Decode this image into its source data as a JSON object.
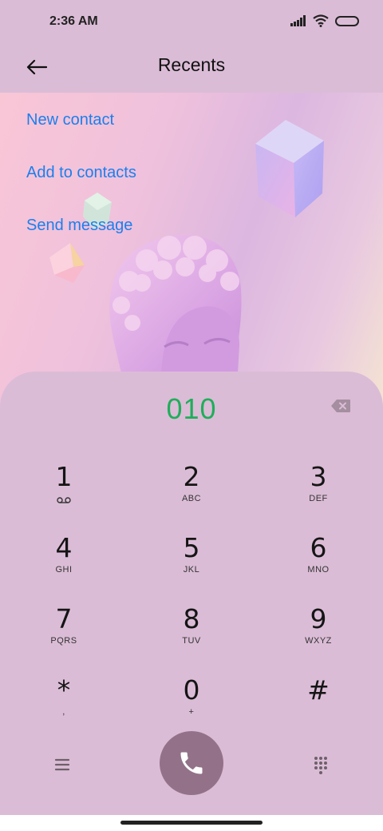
{
  "status_bar": {
    "time": "2:36 AM"
  },
  "header": {
    "title": "Recents"
  },
  "actions": [
    {
      "label": "New contact"
    },
    {
      "label": "Add to contacts"
    },
    {
      "label": "Send message"
    }
  ],
  "dialer": {
    "number": "010",
    "keys": [
      {
        "digit": "1",
        "letters": ""
      },
      {
        "digit": "2",
        "letters": "ABC"
      },
      {
        "digit": "3",
        "letters": "DEF"
      },
      {
        "digit": "4",
        "letters": "GHI"
      },
      {
        "digit": "5",
        "letters": "JKL"
      },
      {
        "digit": "6",
        "letters": "MNO"
      },
      {
        "digit": "7",
        "letters": "PQRS"
      },
      {
        "digit": "8",
        "letters": "TUV"
      },
      {
        "digit": "9",
        "letters": "WXYZ"
      },
      {
        "digit": "*",
        "letters": ","
      },
      {
        "digit": "0",
        "letters": "+"
      },
      {
        "digit": "#",
        "letters": ""
      }
    ]
  },
  "icons": {
    "back": "back-arrow-icon",
    "backspace": "backspace-icon",
    "voicemail": "voicemail-icon",
    "menu": "menu-icon",
    "call": "phone-icon",
    "dialpad": "dialpad-grid-icon",
    "signal": "signal-icon",
    "wifi": "wifi-icon",
    "battery": "battery-icon"
  },
  "colors": {
    "accent_link": "#1b7fee",
    "dialed_number": "#1fae5a",
    "call_button": "#937289",
    "background": "#dbbcd6"
  }
}
